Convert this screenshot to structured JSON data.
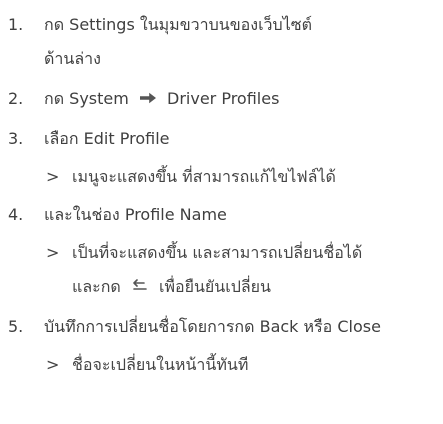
{
  "steps": [
    {
      "number": "1.",
      "line1": "กด Settings ในมุมขวาบนของเว็บไซต์",
      "line2": "ด้านล่าง"
    },
    {
      "number": "2.",
      "part1": "กด System",
      "part2": "Driver Profiles"
    },
    {
      "number": "3.",
      "text": "เลือก Edit Profile"
    },
    {
      "sub_marker": ">",
      "text": "เมนูจะแสดงขึ้น ที่สามารถแก้ไขไฟล์ได้"
    },
    {
      "number": "4.",
      "text": "และในช่อง Profile Name"
    },
    {
      "sub_marker": ">",
      "line1": "เป็นที่จะแสดงขึ้น และสามารถเปลี่ยนชื่อได้",
      "line2_part1": "และกด",
      "line2_part2": "เพื่อยืนยันเปลี่ยน"
    },
    {
      "number": "5.",
      "text": "บันทึกการเปลี่ยนชื่อโดยการกด Back หรือ Close"
    },
    {
      "sub_marker": ">",
      "text": "ชื่อจะเปลี่ยนในหน้านี้ทันที"
    }
  ],
  "icons": {
    "arrow": "right-arrow-icon",
    "return": "return-enter-icon"
  }
}
